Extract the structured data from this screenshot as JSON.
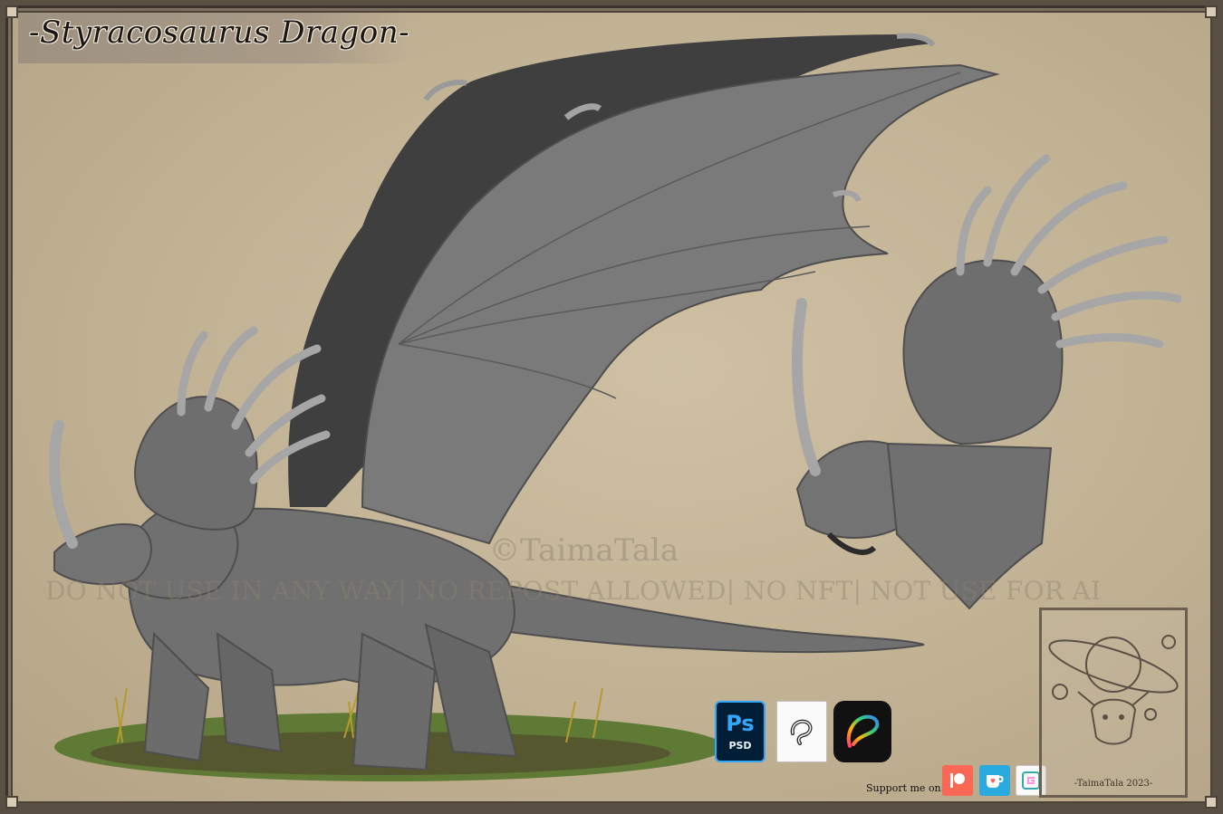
{
  "title": "-Styracosaurus Dragon-",
  "watermark": {
    "name": "©TaimaTala",
    "notice": "DO NOT USE IN ANY WAY| NO REPOST ALLOWED| NO NFT| NOT USE FOR AI"
  },
  "tools": {
    "photoshop": {
      "main": "Ps",
      "sub": "PSD"
    },
    "clip_studio": {
      "icon": "clip-studio-icon"
    },
    "procreate": {
      "icon": "procreate-icon"
    }
  },
  "support": {
    "label": "Support me on:",
    "links": [
      {
        "icon": "patreon-icon"
      },
      {
        "icon": "kofi-icon"
      },
      {
        "icon": "gumroad-icon"
      }
    ]
  },
  "signature": "-TaimaTala 2023-",
  "colors": {
    "background": "#c4b496",
    "body": "#707070",
    "wing_far": "#3f3f3f",
    "horn": "#a6a6a6",
    "grass": "#5f7a35"
  }
}
